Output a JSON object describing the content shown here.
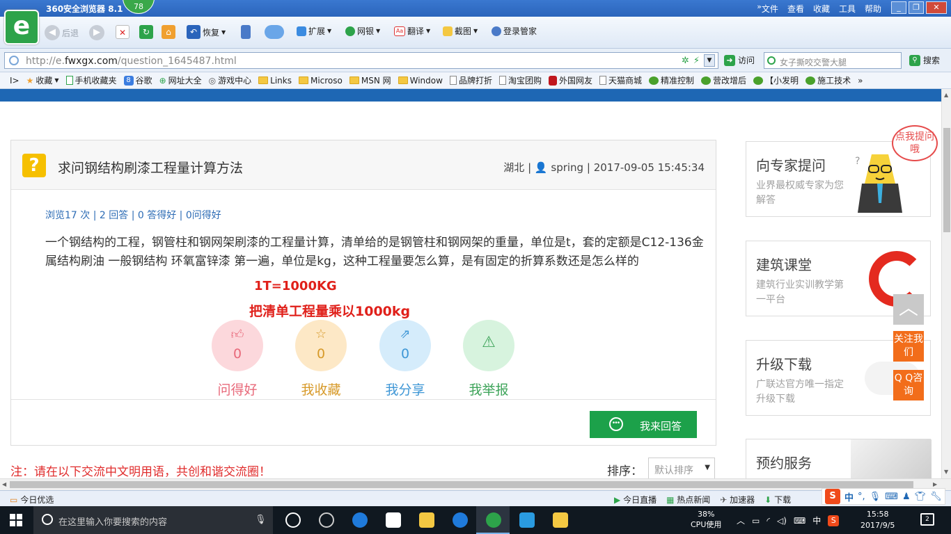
{
  "browser": {
    "title": "360安全浏览器 8.1",
    "score": "78",
    "menu": [
      "文件",
      "查看",
      "收藏",
      "工具",
      "帮助"
    ],
    "toolbar": {
      "back": "后退",
      "restore": "恢复",
      "extend": "扩展",
      "netbank": "网银",
      "translate": "翻译",
      "screenshot": "截图",
      "login": "登录管家"
    },
    "address": {
      "prefix": "http://e.",
      "domain": "fwxgx.com",
      "path": "/question_1645487.html"
    },
    "go_label": "访问",
    "search_placeholder": "女子撕咬交警大腿",
    "search_button": "搜索",
    "favorites": [
      "收藏",
      "手机收藏夹",
      "谷歌",
      "网址大全",
      "游戏中心",
      "Links",
      "Microso",
      "MSN 网",
      "Window",
      "品牌打折",
      "淘宝团购",
      "外国网友",
      "天猫商城",
      "精准控制",
      "营改增后",
      "【小发明",
      "施工技术"
    ]
  },
  "question": {
    "title": "求问钢结构刷漆工程量计算方法",
    "location": "湖北",
    "author": "spring",
    "datetime": "2017-09-05 15:45:34",
    "stats": "浏览17 次 | 2 回答 | 0 答得好 | 0问得好",
    "body": "一个钢结构的工程，钢管柱和钢网架刷漆的工程量计算，清单给的是钢管柱和钢网架的重量，单位是t，套的定额是C12-136金属结构刷油 一般钢结构 环氧富锌漆 第一遍，单位是kg，这种工程量要怎么算，是有固定的折算系数还是怎么样的",
    "answer_line1": "1T=1000KG",
    "answer_line2": "把清单工程量乘以1000kg",
    "actions": [
      {
        "label": "问得好",
        "count": "0"
      },
      {
        "label": "我收藏",
        "count": "0"
      },
      {
        "label": "我分享",
        "count": "0"
      },
      {
        "label": "我举报",
        "count": ""
      }
    ],
    "answer_button": "我来回答"
  },
  "notice": "注：请在以下交流中文明用语，共创和谐交流圈！",
  "sort": {
    "label": "排序：",
    "selected": "默认排序"
  },
  "sidebar": [
    {
      "title": "向专家提问",
      "subtitle": "业界最权威专家为您解答"
    },
    {
      "title": "建筑课堂",
      "subtitle": "建筑行业实训教学第一平台"
    },
    {
      "title": "升级下载",
      "subtitle": "广联达官方唯一指定升级下载"
    },
    {
      "title": "预约服务",
      "subtitle": ""
    }
  ],
  "bubble_text": "点我提问哦",
  "float": {
    "follow": "关注我们",
    "qq": "Q Q咨询"
  },
  "statusbar": {
    "today": "今日优选",
    "items": [
      "今日直播",
      "热点新闻",
      "加速器",
      "下载"
    ]
  },
  "ime": {
    "lang": "中"
  },
  "taskbar": {
    "search_placeholder": "在这里输入你要搜索的内容",
    "cpu_percent": "38%",
    "cpu_label": "CPU使用",
    "lang": "中",
    "time": "15:58",
    "date": "2017/9/5",
    "notifications": "2"
  },
  "colors": {
    "accent_blue": "#1e67b4",
    "answer_green": "#1ca14a",
    "alert_red": "#e0201a",
    "float_orange": "#f26d1a"
  }
}
